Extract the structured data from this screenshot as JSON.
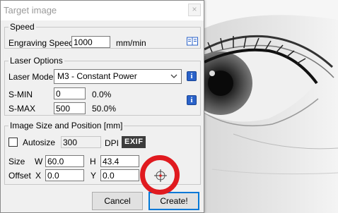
{
  "window": {
    "title": "Target image",
    "close_glyph": "×"
  },
  "speed": {
    "group_title": "Speed",
    "label": "Engraving Speed",
    "value": "1000",
    "unit": "mm/min",
    "help_icon": "book-icon"
  },
  "laser": {
    "group_title": "Laser Options",
    "mode_label": "Laser Mode",
    "mode_value": "M3 - Constant Power",
    "smin_label": "S-MIN",
    "smin_value": "0",
    "smin_pct": "0.0%",
    "smax_label": "S-MAX",
    "smax_value": "500",
    "smax_pct": "50.0%",
    "info_glyph": "i"
  },
  "image": {
    "group_title": "Image Size and Position [mm]",
    "autosize_label": "Autosize",
    "autosize_checked": false,
    "dpi_value": "300",
    "dpi_label": "DPI",
    "exif_label": "EXIF",
    "size_label": "Size",
    "w_label": "W",
    "w_value": "60.0",
    "h_label": "H",
    "h_value": "43.4",
    "offset_label": "Offset",
    "x_label": "X",
    "x_value": "0.0",
    "y_label": "Y",
    "y_value": "0.0",
    "center_icon": "crosshair-icon"
  },
  "buttons": {
    "cancel": "Cancel",
    "create": "Create!"
  },
  "colors": {
    "info_blue": "#2a62c9",
    "highlight_red": "#e01a1f",
    "default_button_border": "#0078d7"
  }
}
